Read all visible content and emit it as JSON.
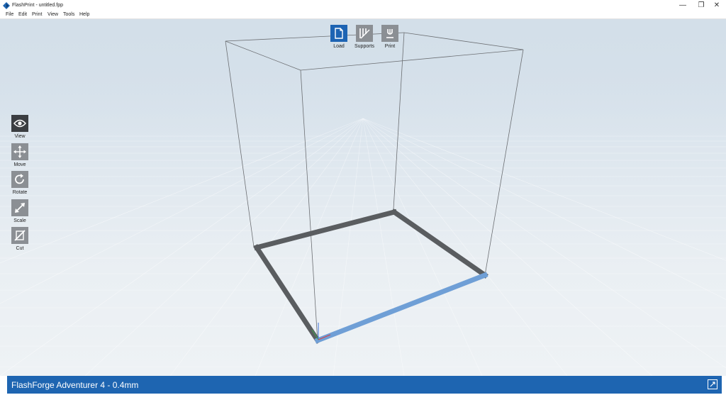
{
  "window": {
    "title": "FlashPrint - untitled.fpp",
    "minimize_glyph": "—",
    "restore_glyph": "❐",
    "close_glyph": "✕"
  },
  "menu": {
    "items": [
      "File",
      "Edit",
      "Print",
      "View",
      "Tools",
      "Help"
    ]
  },
  "top_toolbar": {
    "load": {
      "label": "Load",
      "icon": "file-icon"
    },
    "supports": {
      "label": "Supports",
      "icon": "supports-icon"
    },
    "print": {
      "label": "Print",
      "icon": "print-icon"
    }
  },
  "left_toolbar": {
    "view": {
      "label": "View",
      "icon": "eye-icon",
      "active": true
    },
    "move": {
      "label": "Move",
      "icon": "move-arrows-icon"
    },
    "rotate": {
      "label": "Rotate",
      "icon": "rotate-icon"
    },
    "scale": {
      "label": "Scale",
      "icon": "scale-icon"
    },
    "cut": {
      "label": "Cut",
      "icon": "cut-icon"
    }
  },
  "status": {
    "printer": "FlashForge Adventurer 4 - 0.4mm",
    "icon": "link-icon"
  },
  "colors": {
    "accent": "#1e65b1",
    "active_tool": "#3b3e42",
    "tool": "#8b8f94",
    "bed_frame": "#5a5d60",
    "bed_front_edge": "#6f9fd6"
  }
}
